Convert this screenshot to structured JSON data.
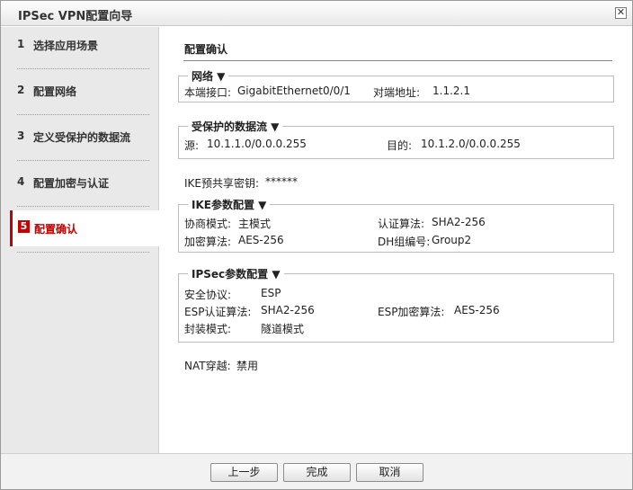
{
  "window": {
    "title": "IPSec VPN配置向导",
    "close_glyph": "✕"
  },
  "sidebar": {
    "steps": [
      {
        "num": "1",
        "label": "选择应用场景"
      },
      {
        "num": "2",
        "label": "配置网络"
      },
      {
        "num": "3",
        "label": "定义受保护的数据流"
      },
      {
        "num": "4",
        "label": "配置加密与认证"
      },
      {
        "num": "5",
        "label": "配置确认",
        "active": true
      }
    ]
  },
  "main": {
    "title": "配置确认",
    "network": {
      "legend": "网络 ▼",
      "local_iface_label": "本端接口:",
      "local_iface_value": "GigabitEthernet0/0/1",
      "peer_addr_label": "对端地址:",
      "peer_addr_value": "1.1.2.1"
    },
    "flow": {
      "legend": "受保护的数据流 ▼",
      "src_label": "源:",
      "src_value": "10.1.1.0/0.0.0.255",
      "dst_label": "目的:",
      "dst_value": "10.1.2.0/0.0.0.255"
    },
    "ike_psk": {
      "label": "IKE预共享密钥:",
      "value": "******"
    },
    "ike": {
      "legend": "IKE参数配置 ▼",
      "nego_label": "协商模式:",
      "nego_value": "主模式",
      "auth_label": "认证算法:",
      "auth_value": "SHA2-256",
      "enc_label": "加密算法:",
      "enc_value": "AES-256",
      "dh_label": "DH组编号:",
      "dh_value": "Group2"
    },
    "ipsec": {
      "legend": "IPSec参数配置 ▼",
      "proto_label": "安全协议:",
      "proto_value": "ESP",
      "esp_auth_label": "ESP认证算法:",
      "esp_auth_value": "SHA2-256",
      "esp_enc_label": "ESP加密算法:",
      "esp_enc_value": "AES-256",
      "encap_label": "封装模式:",
      "encap_value": "隧道模式"
    },
    "nat": {
      "label": "NAT穿越:",
      "value": "禁用"
    }
  },
  "footer": {
    "prev_label": "上一步",
    "finish_label": "完成",
    "cancel_label": "取消"
  }
}
